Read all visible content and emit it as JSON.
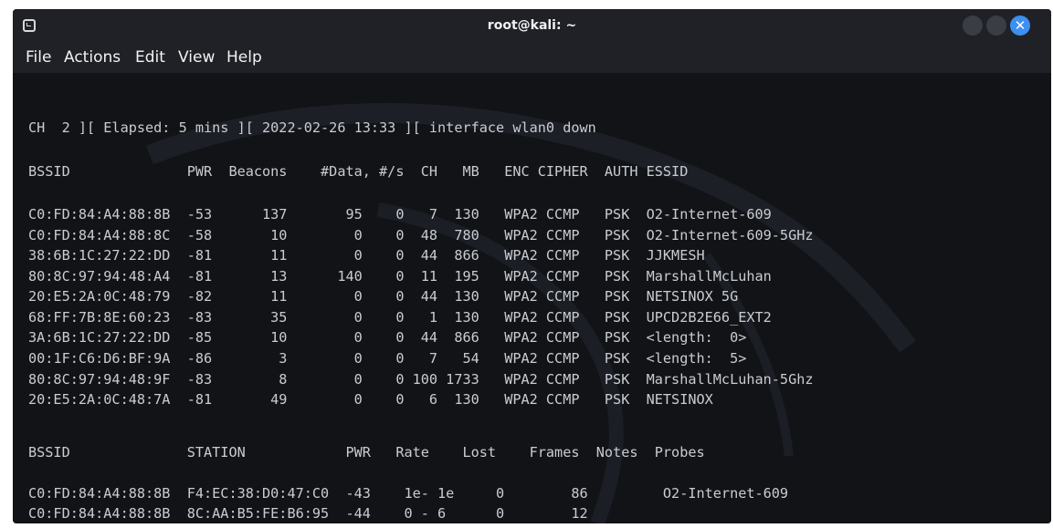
{
  "window": {
    "title": "root@kali: ~"
  },
  "menu": [
    "File",
    "Actions",
    "Edit",
    "View",
    "Help"
  ],
  "status_line": "CH  2 ][ Elapsed: 5 mins ][ 2022-02-26 13:33 ][ interface wlan0 down",
  "ap_header": "BSSID              PWR  Beacons    #Data, #/s  CH   MB   ENC CIPHER  AUTH ESSID",
  "ap_rows": [
    "C0:FD:84:A4:88:8B  -53      137       95    0   7  130   WPA2 CCMP   PSK  O2-Internet-609",
    "C0:FD:84:A4:88:8C  -58       10        0    0  48  780   WPA2 CCMP   PSK  O2-Internet-609-5GHz",
    "38:6B:1C:27:22:DD  -81       11        0    0  44  866   WPA2 CCMP   PSK  JJKMESH",
    "80:8C:97:94:48:A4  -81       13      140    0  11  195   WPA2 CCMP   PSK  MarshallMcLuhan",
    "20:E5:2A:0C:48:79  -82       11        0    0  44  130   WPA2 CCMP   PSK  NETSINOX 5G",
    "68:FF:7B:8E:60:23  -83       35        0    0   1  130   WPA2 CCMP   PSK  UPCD2B2E66_EXT2",
    "3A:6B:1C:27:22:DD  -85       10        0    0  44  866   WPA2 CCMP   PSK  <length:  0>",
    "00:1F:C6:D6:BF:9A  -86        3        0    0   7   54   WPA2 CCMP   PSK  <length:  5>",
    "80:8C:97:94:48:9F  -83        8        0    0 100 1733   WPA2 CCMP   PSK  MarshallMcLuhan-5Ghz",
    "20:E5:2A:0C:48:7A  -81       49        0    0   6  130   WPA2 CCMP   PSK  NETSINOX"
  ],
  "station_header": "BSSID              STATION            PWR   Rate    Lost    Frames  Notes  Probes",
  "station_rows": [
    "C0:FD:84:A4:88:8B  F4:EC:38:D0:47:C0  -43    1e- 1e     0        86         O2-Internet-609",
    "C0:FD:84:A4:88:8B  8C:AA:B5:FE:B6:95  -44    0 - 6      0        12"
  ],
  "colors": {
    "terminal_bg": "#111317",
    "titlebar_bg": "#1f2126",
    "text": "#c9ccd1",
    "close_button": "#3d8ff0"
  },
  "icons": [
    "terminal-icon",
    "minimize-icon",
    "maximize-icon",
    "close-icon"
  ]
}
